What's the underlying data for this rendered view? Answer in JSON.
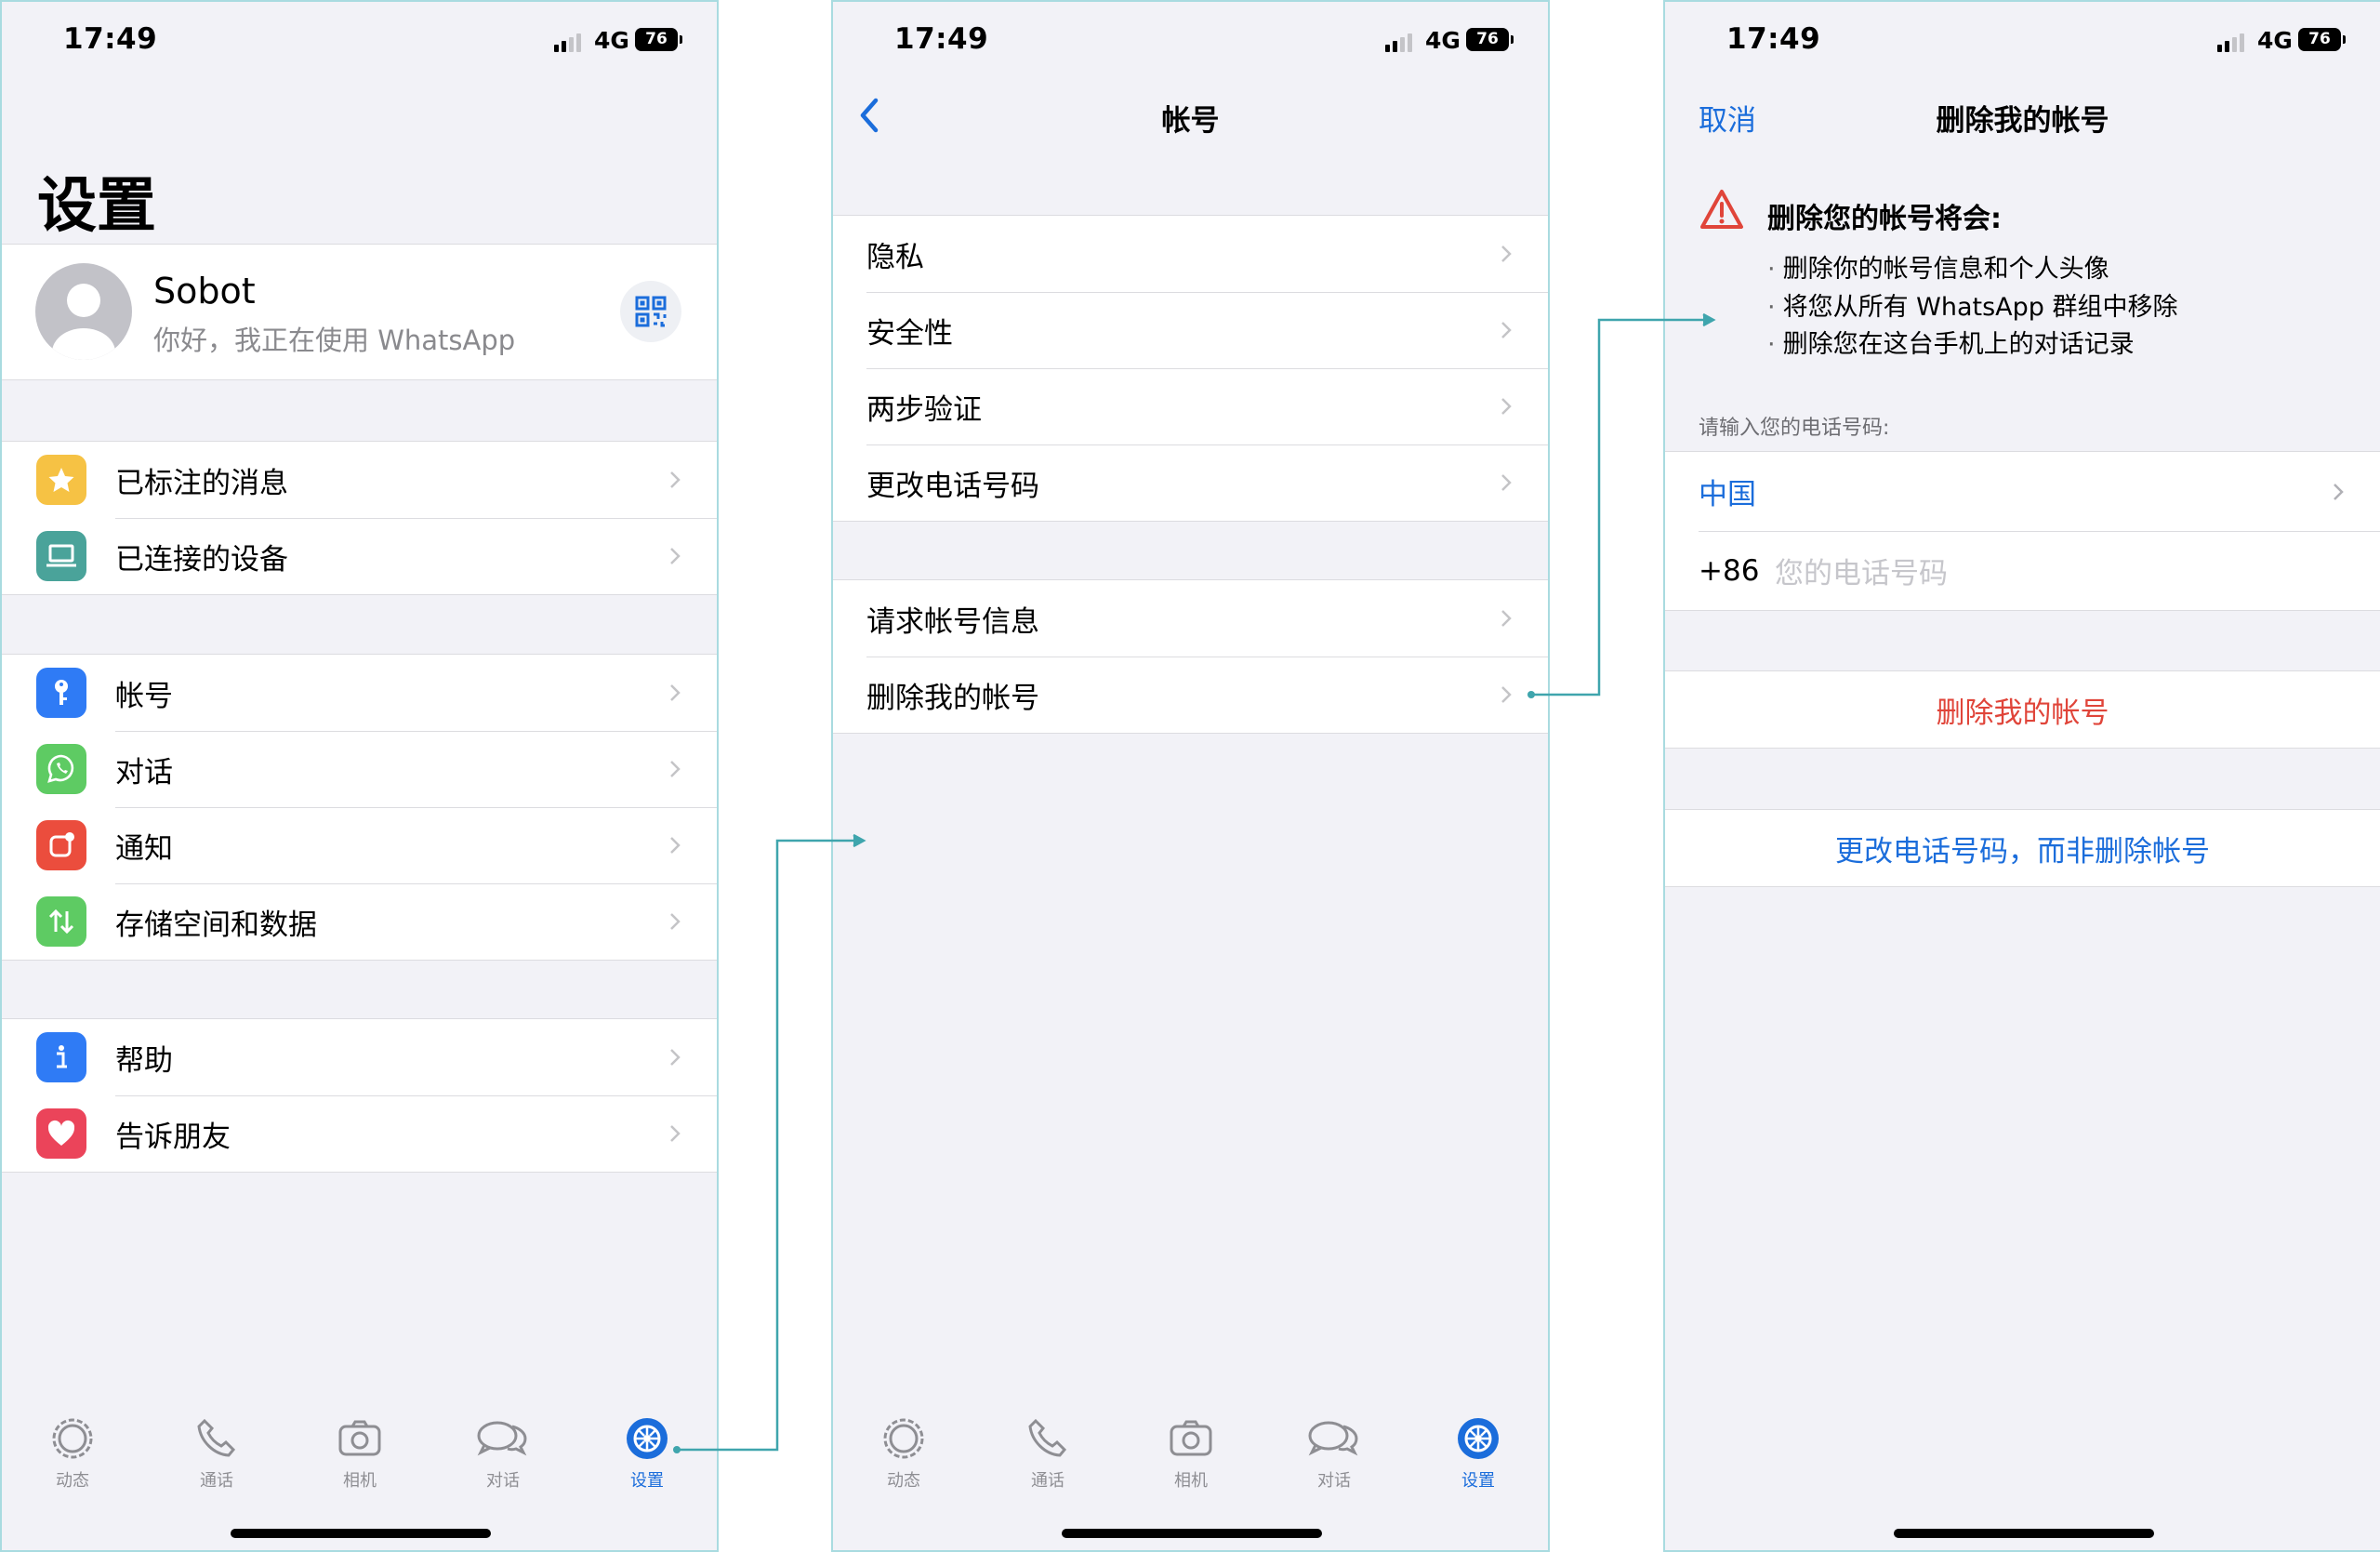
{
  "status_bar": {
    "time": "17:49",
    "network": "4G",
    "battery": "76"
  },
  "screen_settings": {
    "title": "设置",
    "profile": {
      "name": "Sobot",
      "status": "你好，我正在使用 WhatsApp"
    },
    "group1": [
      {
        "label": "已标注的消息",
        "icon": "star-icon",
        "color": "#f6c244"
      },
      {
        "label": "已连接的设备",
        "icon": "laptop-icon",
        "color": "#4aa39a"
      }
    ],
    "group2": [
      {
        "label": "帐号",
        "icon": "key-icon",
        "color": "#2f7bf5"
      },
      {
        "label": "对话",
        "icon": "whatsapp-icon",
        "color": "#5ecb63"
      },
      {
        "label": "通知",
        "icon": "notification-icon",
        "color": "#eb4d3d"
      },
      {
        "label": "存储空间和数据",
        "icon": "arrows-updown-icon",
        "color": "#5ecb63"
      }
    ],
    "group3": [
      {
        "label": "帮助",
        "icon": "info-icon",
        "color": "#2f7bf5"
      },
      {
        "label": "告诉朋友",
        "icon": "heart-icon",
        "color": "#eb445a"
      }
    ]
  },
  "tabbar": {
    "items": [
      {
        "label": "动态",
        "icon": "status-icon"
      },
      {
        "label": "通话",
        "icon": "phone-icon"
      },
      {
        "label": "相机",
        "icon": "camera-icon"
      },
      {
        "label": "对话",
        "icon": "chats-icon"
      },
      {
        "label": "设置",
        "icon": "settings-gear-icon"
      }
    ],
    "active_color": "#1b6ddb"
  },
  "screen_account": {
    "title": "帐号",
    "group1": [
      "隐私",
      "安全性",
      "两步验证",
      "更改电话号码"
    ],
    "group2": [
      "请求帐号信息",
      "删除我的帐号"
    ]
  },
  "screen_delete": {
    "cancel": "取消",
    "title": "删除我的帐号",
    "warning_title": "删除您的帐号将会:",
    "bullets": [
      "删除你的帐号信息和个人头像",
      "将您从所有 WhatsApp 群组中移除",
      "删除您在这台手机上的对话记录"
    ],
    "hint": "请输入您的电话号码:",
    "country": "中国",
    "country_code": "+86",
    "phone_placeholder": "您的电话号码",
    "delete_button": "删除我的帐号",
    "change_number_button": "更改电话号码，而非删除帐号",
    "accent_red": "#e0453a",
    "accent_blue": "#1b6ddb"
  }
}
